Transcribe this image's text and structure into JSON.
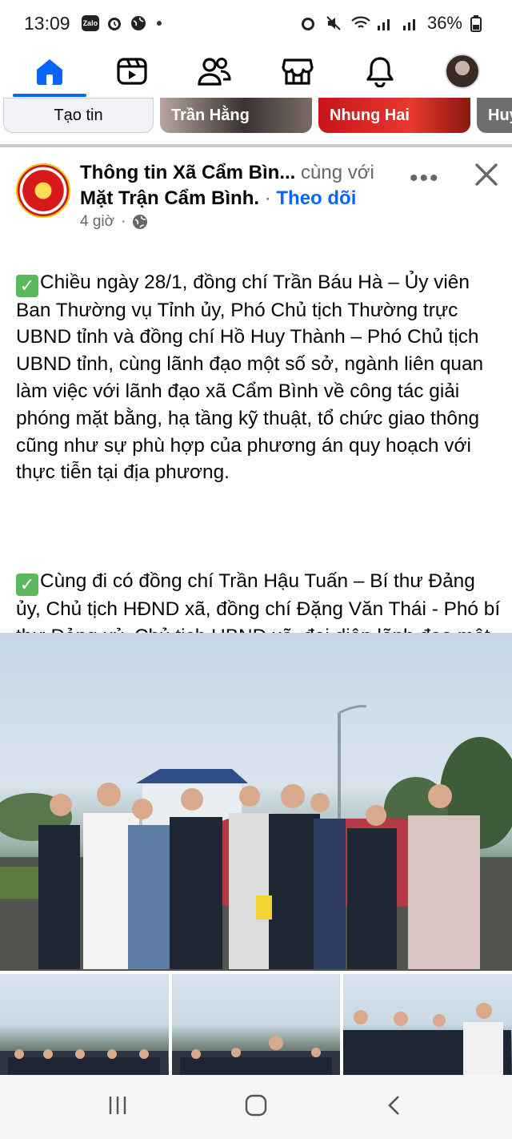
{
  "status_bar": {
    "time": "13:09",
    "chip_label": "Zalo",
    "battery": "36%"
  },
  "nav": {
    "items": [
      "home-icon",
      "video-icon",
      "friends-icon",
      "marketplace-icon",
      "bell-icon",
      "profile-avatar"
    ],
    "active": "home-icon",
    "accent": "#0866ff"
  },
  "stories": {
    "create_label": "Tạo tin",
    "items": [
      "Trần Hằng",
      "Nhung Hai",
      "Huy"
    ]
  },
  "post": {
    "author": "Thông tin Xã Cẩm Bìn...",
    "with_label": "cùng với",
    "coauthor": "Mặt Trận Cẩm Bình.",
    "separator": "·",
    "follow_label": "Theo dõi",
    "time": "4 giờ",
    "privacy_separator": "·",
    "more_label": "•••",
    "paragraph_1": "Chiều ngày 28/1, đồng chí Trần Báu Hà – Ủy viên Ban Thường vụ Tỉnh ủy, Phó Chủ tịch Thường trực UBND tỉnh và đồng chí Hồ Huy Thành – Phó Chủ tịch UBND tỉnh, cùng lãnh đạo một số sở, ngành liên quan làm việc với lãnh đạo xã Cẩm Bình về công tác giải phóng mặt bằng, hạ tầng kỹ thuật, tổ chức giao thông cũng như sự phù hợp của phương án quy hoạch với thực tiễn tại địa phương.",
    "paragraph_2": "Cùng đi có đồng chí Trần Hậu Tuấn – Bí thư Đảng ủy, Chủ tịch HĐND xã, đồng chí Đặng Văn Thái - Phó bí thư Đảng uỷ, Chủ tịch UBND xã, đại diện lãnh đạo một số phòng, ngành liên quan cùng tham gia.",
    "check_glyph": "✓"
  },
  "colors": {
    "link": "#0866ff",
    "muted": "#65676b",
    "check_green": "#5cb85c"
  }
}
